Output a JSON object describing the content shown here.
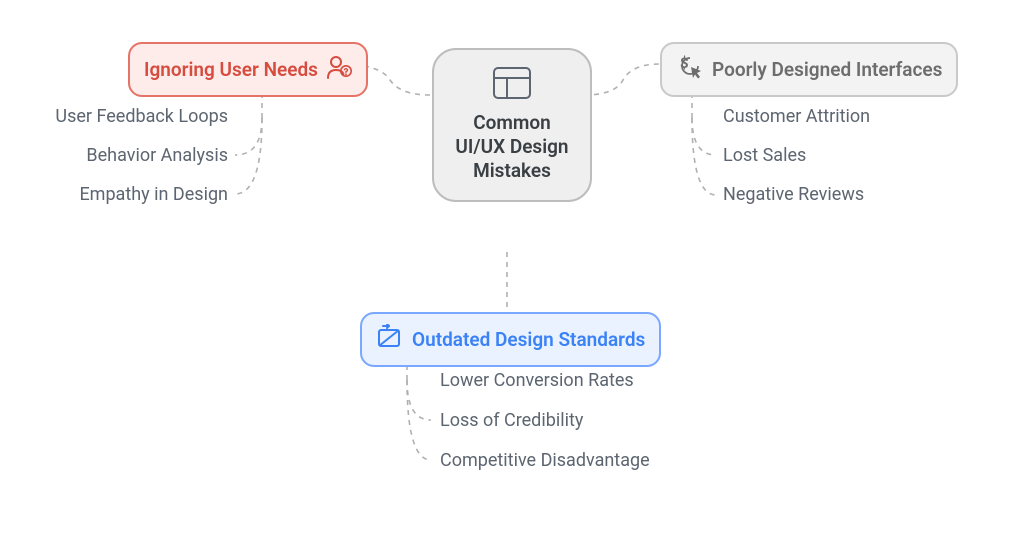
{
  "center": {
    "title": "Common UI/UX Design Mistakes"
  },
  "left": {
    "label": "Ignoring User Needs",
    "items": [
      "User Feedback Loops",
      "Behavior Analysis",
      "Empathy in Design"
    ]
  },
  "right": {
    "label": "Poorly Designed Interfaces",
    "items": [
      "Customer Attrition",
      "Lost Sales",
      "Negative Reviews"
    ]
  },
  "bottom": {
    "label": "Outdated Design Standards",
    "items": [
      "Lower Conversion Rates",
      "Loss of Credibility",
      "Competitive Disadvantage"
    ]
  }
}
